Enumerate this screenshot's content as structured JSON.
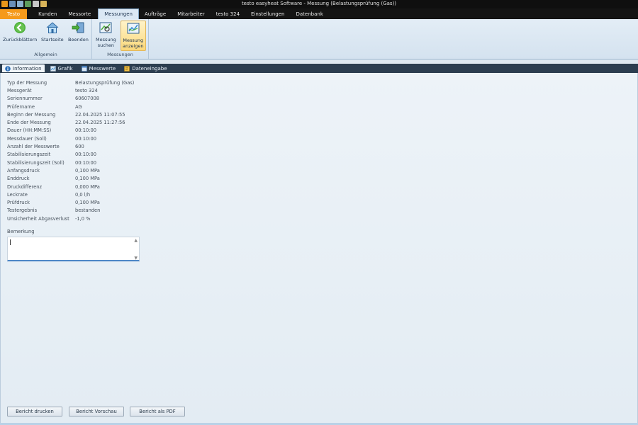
{
  "window": {
    "title": "testo easyheat Software - Messung (Belastungsprüfung (Gas))"
  },
  "ribbon_tabs": [
    {
      "label": "Testo"
    },
    {
      "label": "Kunden"
    },
    {
      "label": "Messorte"
    },
    {
      "label": "Messungen"
    },
    {
      "label": "Aufträge"
    },
    {
      "label": "Mitarbeiter"
    },
    {
      "label": "testo 324"
    },
    {
      "label": "Einstellungen"
    },
    {
      "label": "Datenbank"
    }
  ],
  "ribbon": {
    "groups": {
      "allgemein": "Allgemein",
      "messungen": "Messungen"
    },
    "buttons": {
      "zurueck": "Zurückblättern",
      "startseite": "Startseite",
      "beenden": "Beenden",
      "suchen_l1": "Messung",
      "suchen_l2": "suchen",
      "anzeigen_l1": "Messung",
      "anzeigen_l2": "anzeigen"
    }
  },
  "content_tabs": [
    {
      "label": "Information",
      "icon": "info-icon"
    },
    {
      "label": "Grafik",
      "icon": "chart-icon"
    },
    {
      "label": "Messwerte",
      "icon": "table-icon"
    },
    {
      "label": "Dateneingabe",
      "icon": "data-entry-icon"
    }
  ],
  "info": [
    {
      "label": "Typ der Messung",
      "value": "Belastungsprüfung (Gas)"
    },
    {
      "label": "Messgerät",
      "value": "testo 324"
    },
    {
      "label": "Seriennummer",
      "value": "60607008"
    },
    {
      "label": "Prüfername",
      "value": "AG"
    },
    {
      "label": "Beginn der Messung",
      "value": "22.04.2025 11:07:55"
    },
    {
      "label": "Ende der Messung",
      "value": "22.04.2025 11:27:56"
    },
    {
      "label": "Dauer (HH:MM:SS)",
      "value": "00:10:00"
    },
    {
      "label": "Messdauer (Soll)",
      "value": "00:10:00"
    },
    {
      "label": "Anzahl der Messwerte",
      "value": "600"
    },
    {
      "label": "Stabilisierungszeit",
      "value": "00:10:00"
    },
    {
      "label": "Stabilisierungszeit (Soll)",
      "value": "00:10:00"
    },
    {
      "label": "Anfangsdruck",
      "value": "0,100 MPa"
    },
    {
      "label": "Enddruck",
      "value": "0,100 MPa"
    },
    {
      "label": "Druckdifferenz",
      "value": "0,000 MPa"
    },
    {
      "label": "Leckrate",
      "value": "0,0 l/h"
    },
    {
      "label": "Prüfdruck",
      "value": "0,100 MPa"
    },
    {
      "label": "Testergebnis",
      "value": "bestanden"
    },
    {
      "label": "Unsicherheit Abgasverlust",
      "value": "-1,0 %"
    }
  ],
  "remark": {
    "label": "Bemerkung",
    "value": ""
  },
  "actions": {
    "print": "Bericht drucken",
    "preview": "Bericht Vorschau",
    "pdf": "Bericht als PDF"
  },
  "colors": {
    "app_tab": "#f59a1c",
    "content_tab_bar": "#2c3e50",
    "selected_ribbon_button": "#fbd87a"
  }
}
